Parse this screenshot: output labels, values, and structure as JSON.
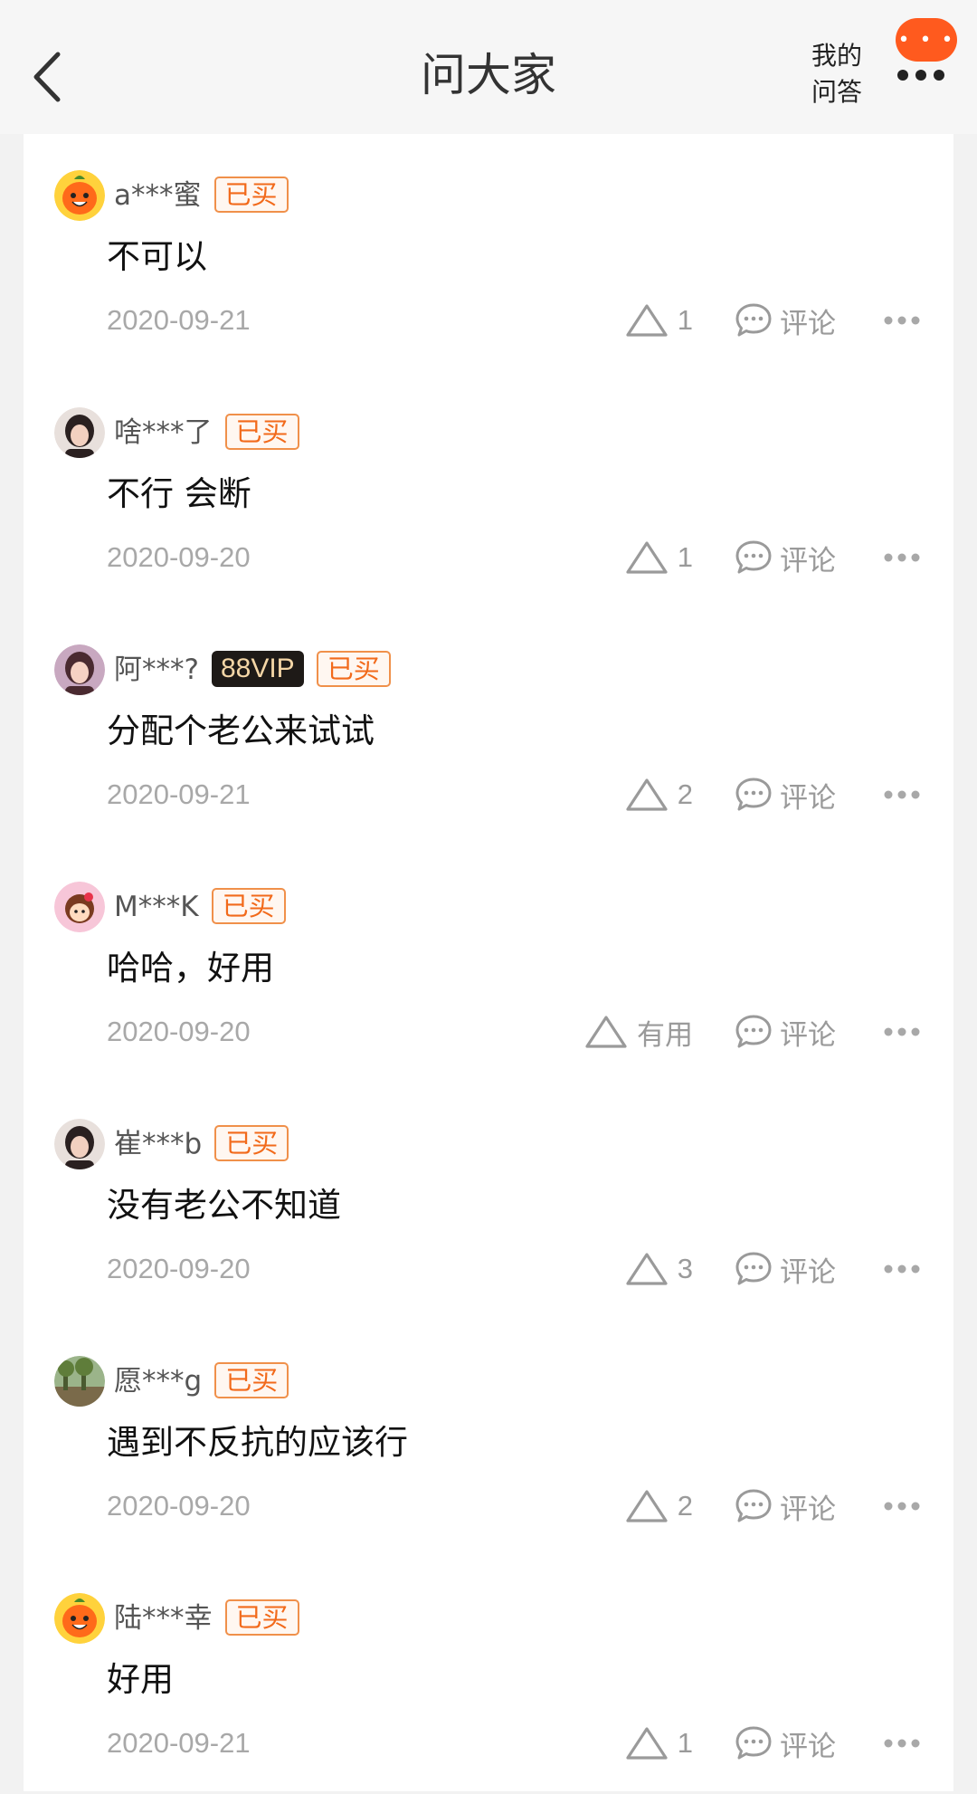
{
  "header": {
    "title": "问大家",
    "my_qa_line1": "我的",
    "my_qa_line2": "问答",
    "badge_text": "• • •"
  },
  "colors": {
    "bought_badge": "#f26a1b",
    "vip_badge_bg": "#1e1a17",
    "message_badge": "#ff5a1e"
  },
  "answers": [
    {
      "user": "a***蜜",
      "vip": "",
      "bought": "已买",
      "text": "不可以",
      "date": "2020-09-21",
      "likes": "1",
      "comment_label": "评论",
      "avatar": "orange-mascot"
    },
    {
      "user": "啥***了",
      "vip": "",
      "bought": "已买",
      "text": "不行 会断",
      "date": "2020-09-20",
      "likes": "1",
      "comment_label": "评论",
      "avatar": "photo"
    },
    {
      "user": "阿***?",
      "vip": "88VIP",
      "bought": "已买",
      "text": "分配个老公来试试",
      "date": "2020-09-21",
      "likes": "2",
      "comment_label": "评论",
      "avatar": "photo"
    },
    {
      "user": "M***K",
      "vip": "",
      "bought": "已买",
      "text": "哈哈，好用",
      "date": "2020-09-20",
      "likes": "有用",
      "comment_label": "评论",
      "avatar": "cartoon-girl"
    },
    {
      "user": "崔***b",
      "vip": "",
      "bought": "已买",
      "text": "没有老公不知道",
      "date": "2020-09-20",
      "likes": "3",
      "comment_label": "评论",
      "avatar": "photo"
    },
    {
      "user": "愿***g",
      "vip": "",
      "bought": "已买",
      "text": "遇到不反抗的应该行",
      "date": "2020-09-20",
      "likes": "2",
      "comment_label": "评论",
      "avatar": "landscape"
    },
    {
      "user": "陆***幸",
      "vip": "",
      "bought": "已买",
      "text": "好用",
      "date": "2020-09-21",
      "likes": "1",
      "comment_label": "评论",
      "avatar": "orange-mascot"
    }
  ]
}
